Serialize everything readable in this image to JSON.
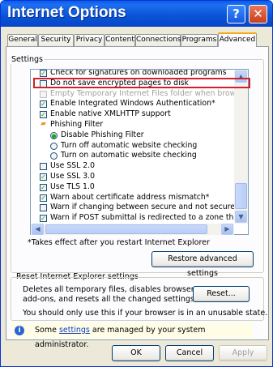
{
  "window": {
    "title": "Internet Options"
  },
  "tabs": [
    {
      "label": "General"
    },
    {
      "label": "Security"
    },
    {
      "label": "Privacy"
    },
    {
      "label": "Content"
    },
    {
      "label": "Connections"
    },
    {
      "label": "Programs"
    },
    {
      "label": "Advanced"
    }
  ],
  "settings": {
    "group_label": "Settings",
    "items": [
      {
        "label": "Check for signatures on downloaded programs",
        "state": "checked"
      },
      {
        "label": "Do not save encrypted pages to disk",
        "state": "unchecked"
      },
      {
        "label": "Empty Temporary Internet Files folder when browser is c",
        "state": "disabled"
      },
      {
        "label": "Enable Integrated Windows Authentication*",
        "state": "checked"
      },
      {
        "label": "Enable native XMLHTTP support",
        "state": "checked"
      },
      {
        "label": "Phishing Filter",
        "state": "folder"
      },
      {
        "label": "Disable Phishing Filter",
        "state": "radio-selected"
      },
      {
        "label": "Turn off automatic website checking",
        "state": "radio"
      },
      {
        "label": "Turn on automatic website checking",
        "state": "radio"
      },
      {
        "label": "Use SSL 2.0",
        "state": "unchecked"
      },
      {
        "label": "Use SSL 3.0",
        "state": "checked"
      },
      {
        "label": "Use TLS 1.0",
        "state": "checked"
      },
      {
        "label": "Warn about certificate address mismatch*",
        "state": "checked"
      },
      {
        "label": "Warn if changing between secure and not secure mode",
        "state": "unchecked"
      },
      {
        "label": "Warn if POST submittal is redirected to a zone that does",
        "state": "checked"
      }
    ],
    "note": "*Takes effect after you restart Internet Explorer",
    "restore_button": "Restore advanced settings"
  },
  "reset": {
    "group_label": "Reset Internet Explorer settings",
    "description_line1": "Deletes all temporary files, disables browser",
    "description_line2": "add-ons, and resets all the changed settings.",
    "button": "Reset...",
    "warning": "You should only use this if your browser is in an unusable state."
  },
  "info": {
    "prefix": "Some ",
    "link": "settings",
    "suffix": " are managed by your system administrator."
  },
  "footer": {
    "ok": "OK",
    "cancel": "Cancel",
    "apply": "Apply"
  },
  "colors": {
    "titlebar": "#0a53d6",
    "highlight_box": "#d0202a",
    "check_mark": "#21a121"
  },
  "icons": {
    "help": "question-mark",
    "close": "x",
    "phishing_folder": "folder",
    "info": "info-circle"
  }
}
